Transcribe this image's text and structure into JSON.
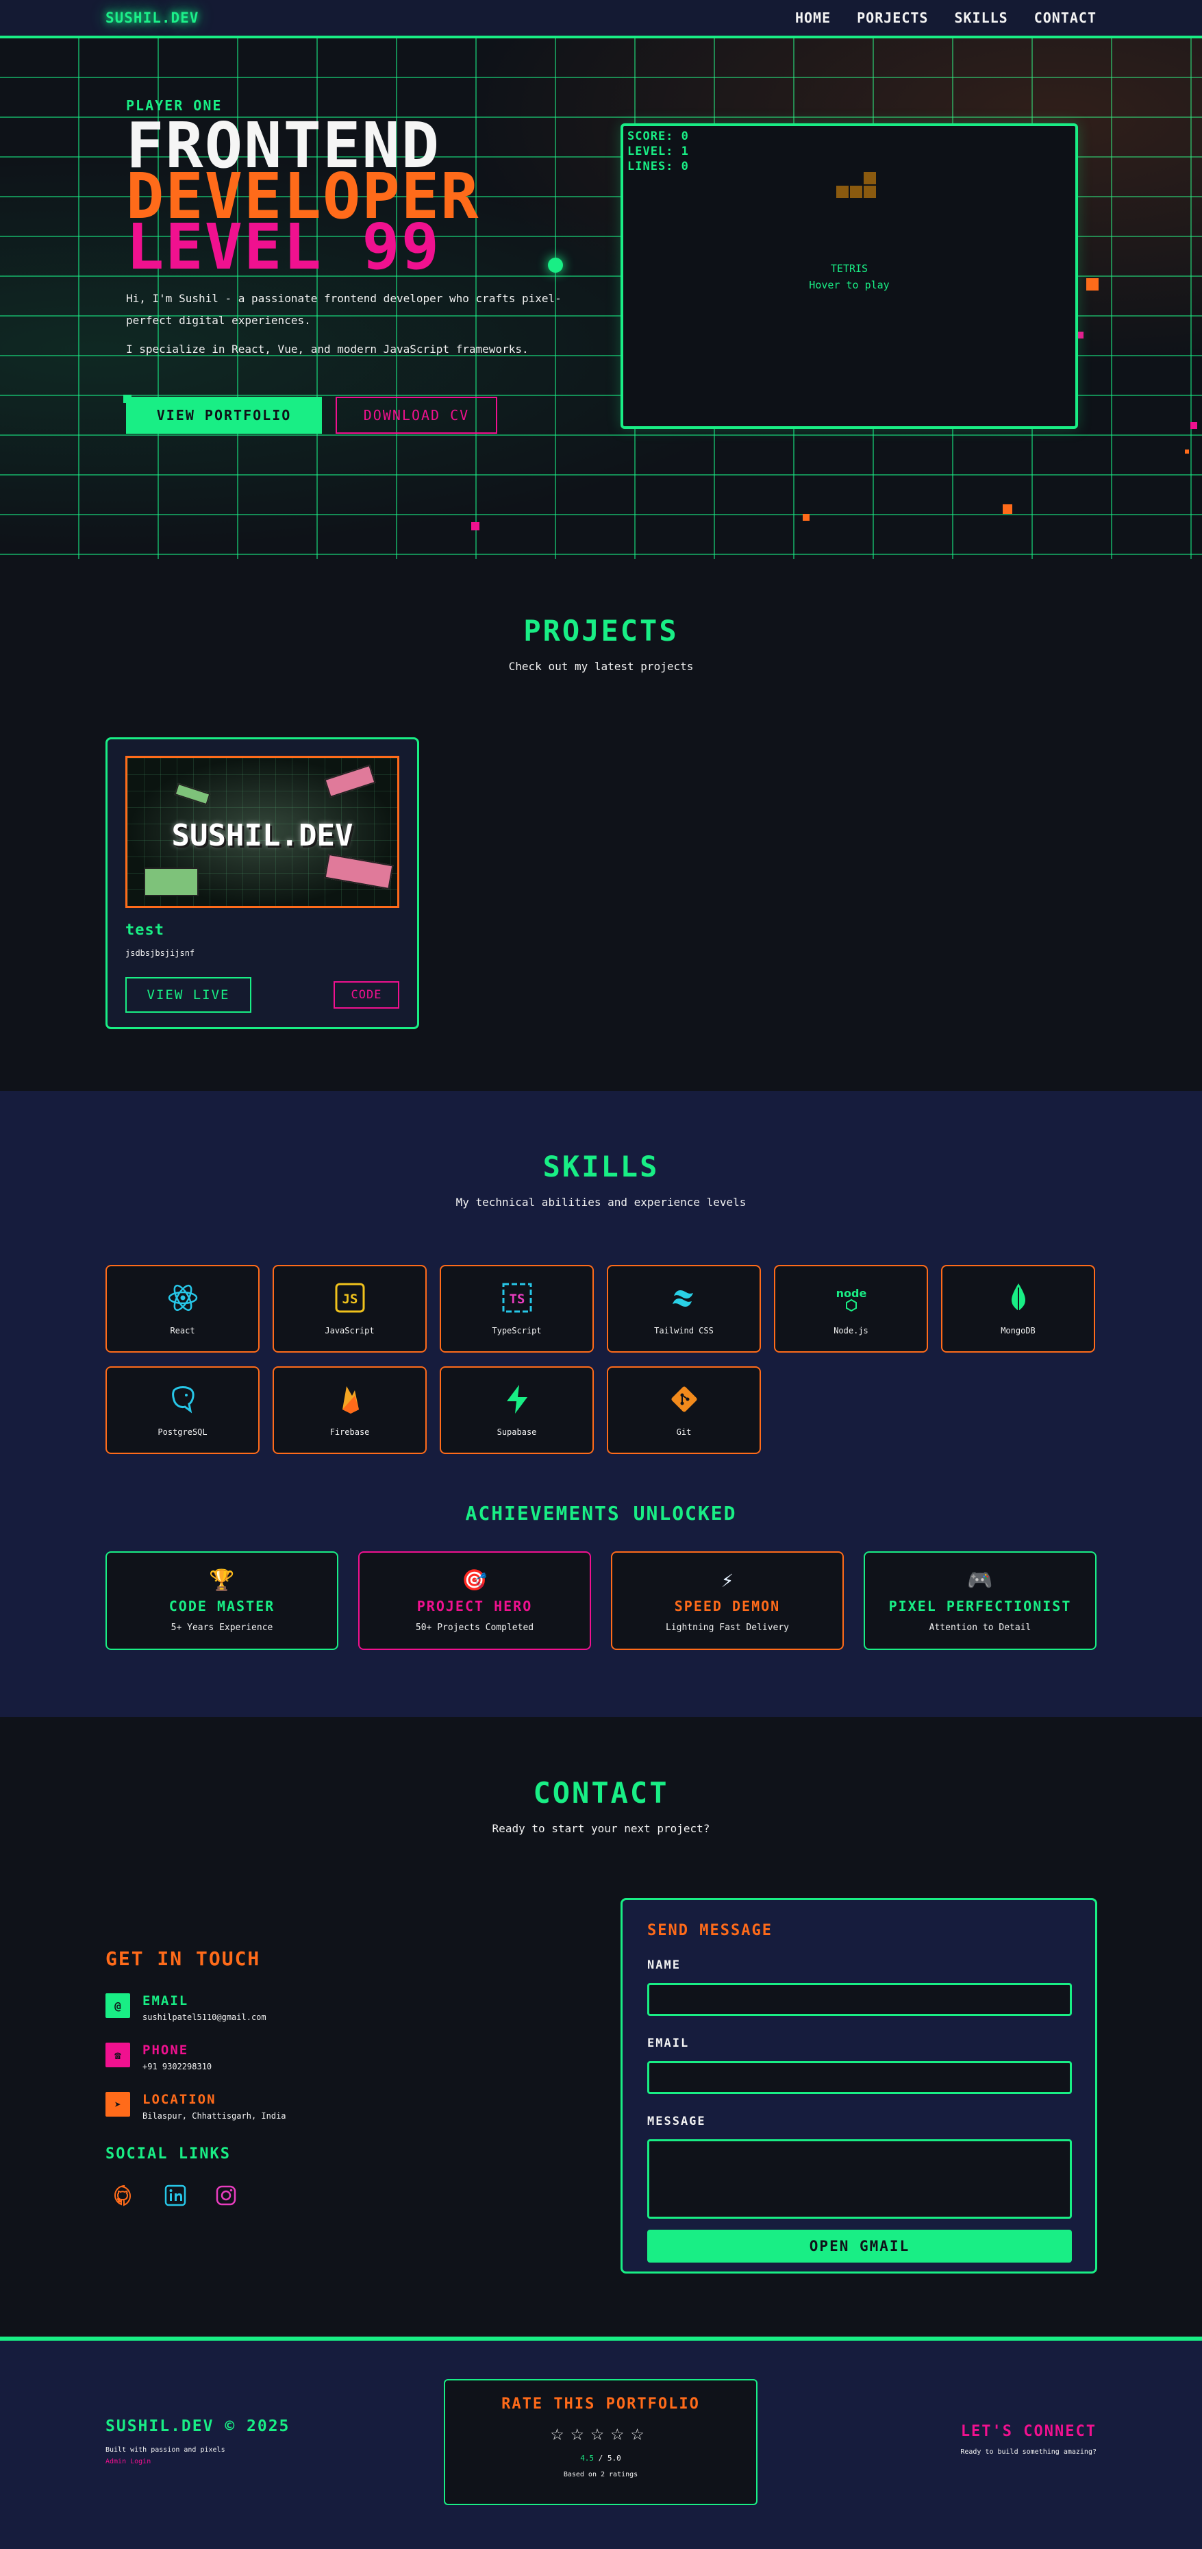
{
  "nav": {
    "logo": "SUSHIL.DEV",
    "links": [
      "HOME",
      "PORJECTS",
      "SKILLS",
      "CONTACT"
    ]
  },
  "hero": {
    "eyebrow": "PLAYER ONE",
    "title": [
      "FRONTEND",
      "DEVELOPER",
      "LEVEL 99"
    ],
    "intro": "Hi, I'm Sushil - a passionate frontend developer who crafts pixel-perfect digital experiences.",
    "specialty": "I specialize in React, Vue, and modern JavaScript frameworks.",
    "primary_button": "VIEW PORTFOLIO",
    "secondary_button": "DOWNLOAD CV"
  },
  "tetris": {
    "score": "SCORE: 0",
    "level": "LEVEL: 1",
    "lines": "LINES: 0",
    "name": "TETRIS",
    "hint": "Hover to play"
  },
  "projects": {
    "title": "PROJECTS",
    "subtitle": "Check out my latest projects",
    "items": [
      {
        "thumb_text": "SUSHIL.DEV",
        "name": "test",
        "description": "jsdbsjbsjijsnf",
        "live_label": "VIEW LIVE",
        "code_label": "CODE"
      }
    ]
  },
  "skills": {
    "title": "SKILLS",
    "subtitle": "My technical abilities and experience levels",
    "items": [
      {
        "name": "React",
        "icon": "react-icon",
        "color": "#27c7e8"
      },
      {
        "name": "JavaScript",
        "icon": "javascript-icon",
        "color": "#f0c21c"
      },
      {
        "name": "TypeScript",
        "icon": "typescript-icon",
        "color": "#e83dbf"
      },
      {
        "name": "Tailwind CSS",
        "icon": "tailwind-icon",
        "color": "#2ad0e6"
      },
      {
        "name": "Node.js",
        "icon": "nodejs-icon",
        "color": "#19ee85"
      },
      {
        "name": "MongoDB",
        "icon": "mongodb-icon",
        "color": "#19ee85"
      },
      {
        "name": "PostgreSQL",
        "icon": "postgresql-icon",
        "color": "#27c7e8"
      },
      {
        "name": "Firebase",
        "icon": "firebase-icon",
        "color": "#f5a623"
      },
      {
        "name": "Supabase",
        "icon": "supabase-icon",
        "color": "#19ee85"
      },
      {
        "name": "Git",
        "icon": "git-icon",
        "color": "#f28a1c"
      }
    ]
  },
  "achievements": {
    "title": "ACHIEVEMENTS UNLOCKED",
    "items": [
      {
        "icon": "🏆",
        "name": "CODE MASTER",
        "desc": "5+ Years Experience",
        "color": "#19ee85"
      },
      {
        "icon": "🎯",
        "name": "PROJECT HERO",
        "desc": "50+ Projects Completed",
        "color": "#f0118f"
      },
      {
        "icon": "⚡",
        "name": "SPEED DEMON",
        "desc": "Lightning Fast Delivery",
        "color": "#ff6b1a"
      },
      {
        "icon": "🎮",
        "name": "PIXEL PERFECTIONIST",
        "desc": "Attention to Detail",
        "color": "#19ee85"
      }
    ]
  },
  "contact": {
    "title": "CONTACT",
    "subtitle": "Ready to start your next project?",
    "get_in_touch": "GET IN TOUCH",
    "email_label": "EMAIL",
    "email_value": "sushilpatel5110@gmail.com",
    "phone_label": "PHONE",
    "phone_value": "+91 9302298310",
    "location_label": "LOCATION",
    "location_value": "Bilaspur, Chhattisgarh, India",
    "social_title": "SOCIAL LINKS",
    "form_title": "SEND MESSAGE",
    "name_label": "NAME",
    "form_email_label": "EMAIL",
    "message_label": "MESSAGE",
    "submit_label": "OPEN GMAIL"
  },
  "footer": {
    "brand": "SUSHIL.DEV © 2025",
    "tagline": "Built with passion and pixels",
    "admin": "Admin Login",
    "rate_title": "RATE THIS PORTFOLIO",
    "stars": "☆☆☆☆☆",
    "rating_value": "4.5",
    "rating_max": " / 5.0",
    "rating_count": "Based on 2 ratings",
    "connect": "LET'S CONNECT",
    "connect_sub": "Ready to build something amazing?"
  },
  "colors": {
    "green": "#19ee85",
    "orange": "#ff6b1a",
    "pink": "#f0118f",
    "navy": "#161c3d",
    "dark": "#0f1219"
  }
}
